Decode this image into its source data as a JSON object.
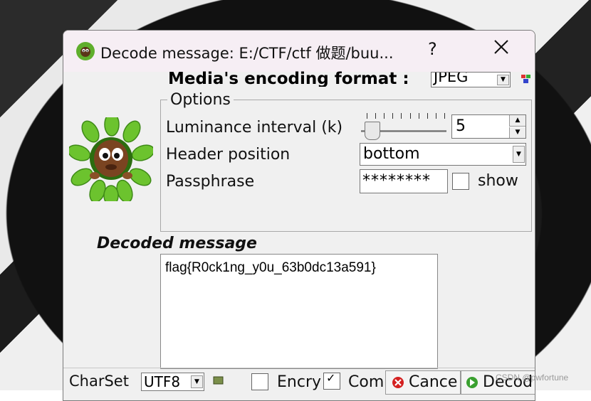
{
  "window": {
    "title": "Decode message: E:/CTF/ctf 做题/buu...",
    "help_label": "?",
    "close_icon": "close-icon"
  },
  "encoding": {
    "label": "Media's encoding format :",
    "value": "JPEG"
  },
  "options": {
    "legend": "Options",
    "luminance_label": "Luminance interval (k)",
    "luminance_value": "5",
    "header_label": "Header position",
    "header_value": "bottom",
    "passphrase_label": "Passphrase",
    "passphrase_value": "********",
    "show_label": "show",
    "show_checked": false
  },
  "decoded": {
    "label": "Decoded message",
    "message": "flag{R0ck1ng_y0u_63b0dc13a591}"
  },
  "bottom": {
    "charset_label": "CharSet",
    "charset_value": "UTF8",
    "encrypt_label": "Encry",
    "encrypt_checked": false,
    "compress_label": "Com",
    "compress_checked": true,
    "cancel_label": "Cance",
    "decode_label": "Decod"
  },
  "watermark": "CSDN @pwfortune",
  "colors": {
    "titlebar_bg": "#f6eef4",
    "window_bg": "#f0f0f0",
    "cancel_icon": "#d42020",
    "decode_icon": "#3aa030"
  }
}
